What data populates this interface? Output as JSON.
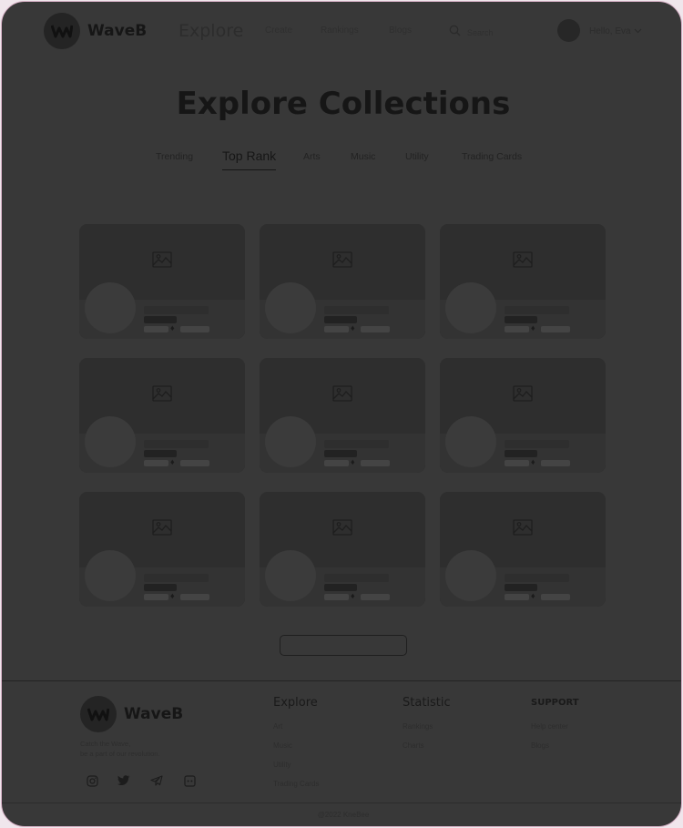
{
  "header": {
    "brand": "WaveB",
    "explore_label": "Explore",
    "nav": [
      "Create",
      "Rankings",
      "Blogs"
    ],
    "search_placeholder": "Search",
    "user_greeting": "Hello, Eva"
  },
  "page": {
    "title": "Explore Collections",
    "tabs": [
      "Trending",
      "Top Rank",
      "Arts",
      "Music",
      "Utility",
      "Trading Cards"
    ],
    "active_tab": "Top Rank"
  },
  "collections": {
    "card_count": 9,
    "image_icon": "image-placeholder-icon",
    "price_symbol": "♦"
  },
  "footer": {
    "brand": "WaveB",
    "tagline_line1": "Catch the Wave,",
    "tagline_line2": "be a part of our revolution.",
    "social_icons": [
      "instagram-icon",
      "twitter-icon",
      "telegram-icon",
      "discord-icon"
    ],
    "explore": {
      "heading": "Explore",
      "links": [
        "Art",
        "Music",
        "Utility",
        "Trading Cards"
      ]
    },
    "statistic": {
      "heading": "Statistic",
      "links": [
        "Rankings",
        "Charts"
      ]
    },
    "support": {
      "heading": "SUPPORT",
      "links": [
        "Help center",
        "Blogs"
      ]
    },
    "copyright": "@2022 KneBee"
  },
  "colors": {
    "overlay": "#383838",
    "card": "#2b2b2b",
    "frame_border": "#d9b3c8"
  }
}
